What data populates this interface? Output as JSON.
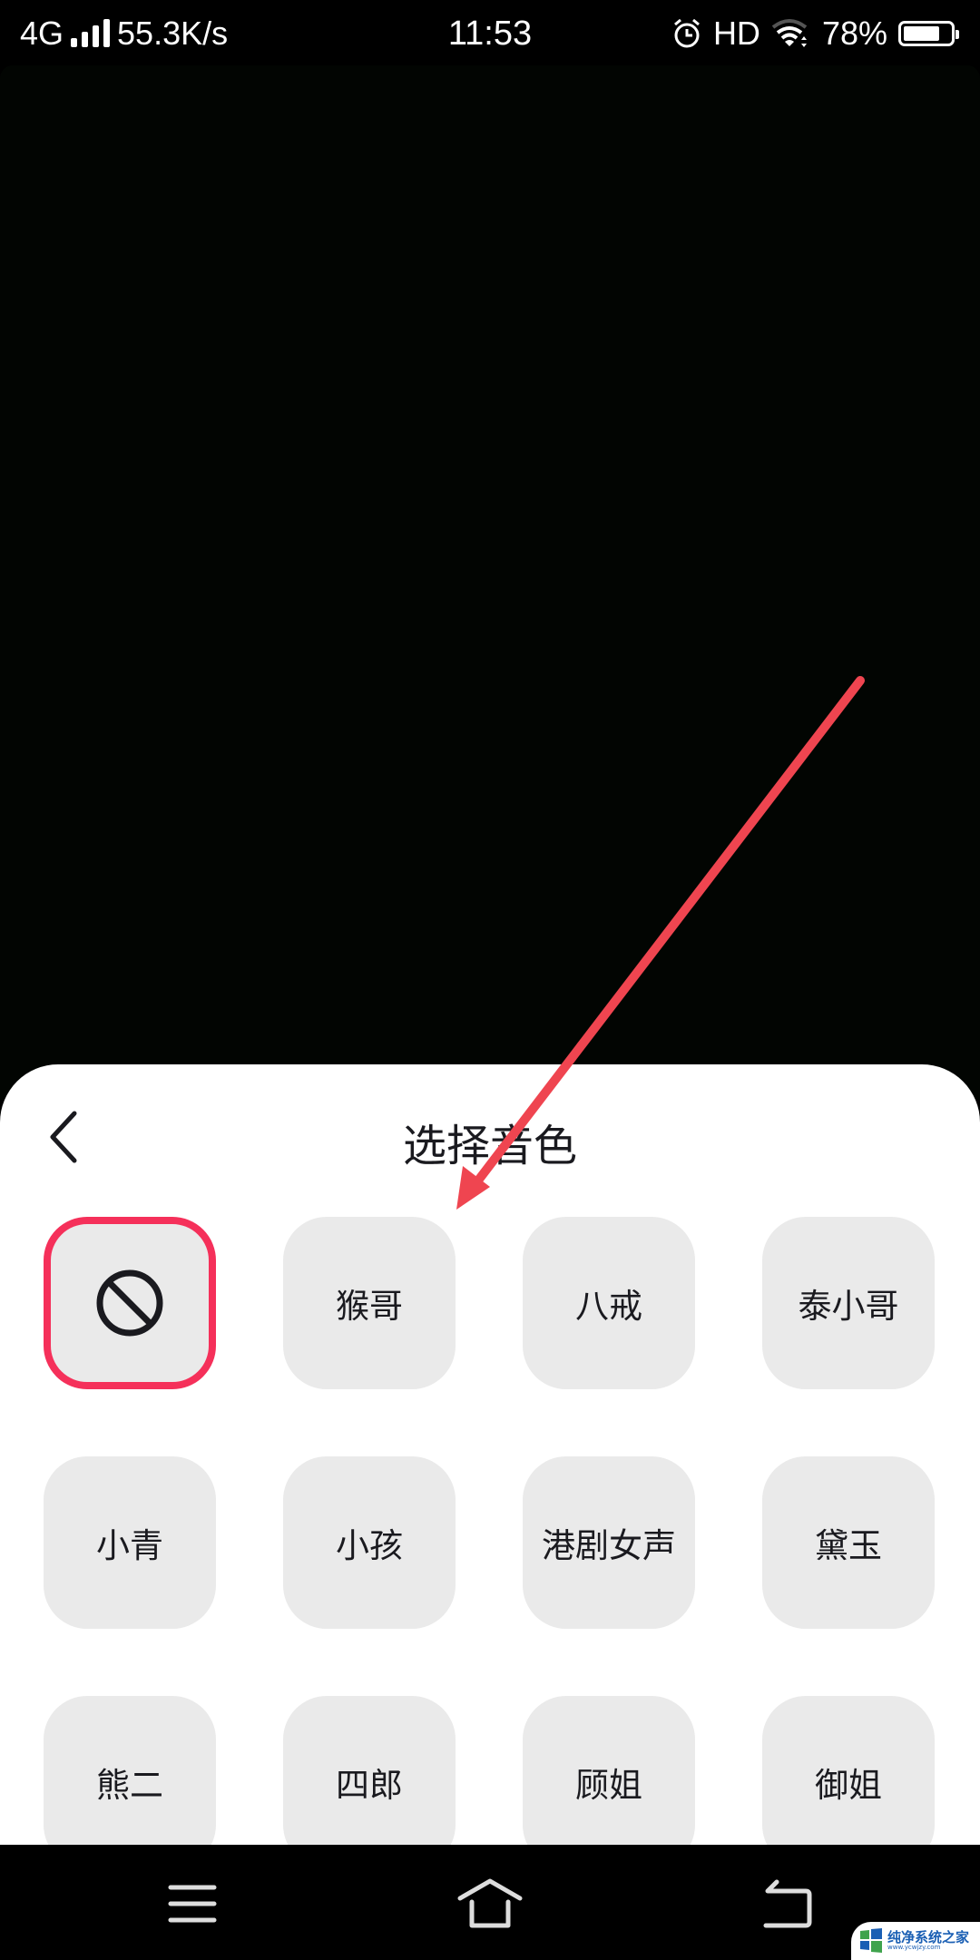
{
  "status_bar": {
    "network": "4G",
    "speed": "55.3K/s",
    "time": "11:53",
    "hd_label": "HD",
    "battery_text": "78%",
    "battery_level": 0.78
  },
  "sheet": {
    "title": "选择音色",
    "back_icon": "chevron-left-icon",
    "voices": [
      {
        "label": "",
        "icon": "no-entry-icon",
        "selected": true
      },
      {
        "label": "猴哥",
        "selected": false
      },
      {
        "label": "八戒",
        "selected": false
      },
      {
        "label": "泰小哥",
        "selected": false
      },
      {
        "label": "小青",
        "selected": false
      },
      {
        "label": "小孩",
        "selected": false
      },
      {
        "label": "港剧女声",
        "selected": false
      },
      {
        "label": "黛玉",
        "selected": false
      },
      {
        "label": "熊二",
        "selected": false
      },
      {
        "label": "四郎",
        "selected": false
      },
      {
        "label": "顾姐",
        "selected": false
      },
      {
        "label": "御姐",
        "selected": false
      }
    ]
  },
  "nav_bar": {
    "menu_icon": "menu-icon",
    "home_icon": "home-icon",
    "back_icon": "back-icon"
  },
  "watermark": {
    "name": "纯净系统之家",
    "url": "www.ycwjzy.com"
  },
  "colors": {
    "accent": "#f5305a",
    "annotation_arrow": "#ef4550",
    "tile_bg": "#eaeaea"
  }
}
